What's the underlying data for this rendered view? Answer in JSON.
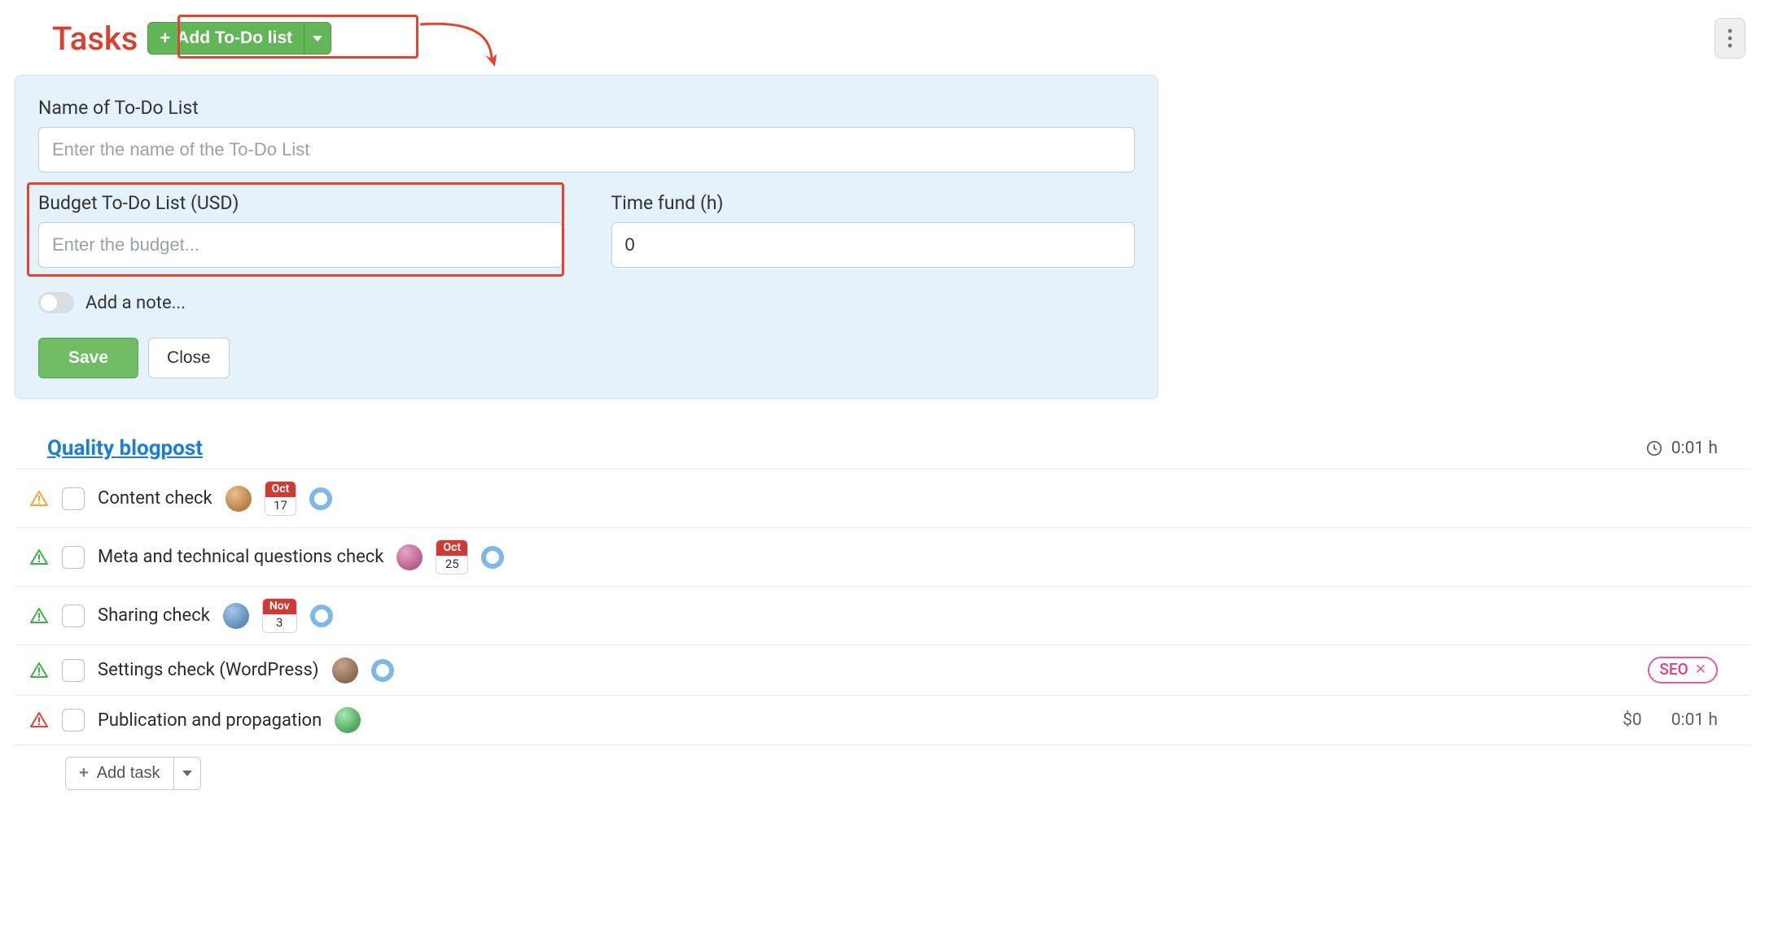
{
  "header": {
    "title": "Tasks",
    "add_button": "Add To-Do list"
  },
  "form": {
    "name_label": "Name of To-Do List",
    "name_placeholder": "Enter the name of the To-Do List",
    "budget_label": "Budget To-Do List (USD)",
    "budget_placeholder": "Enter the budget...",
    "timefund_label": "Time fund (h)",
    "timefund_value": "0",
    "note_label": "Add a note...",
    "save": "Save",
    "close": "Close"
  },
  "list": {
    "title": "Quality blogpost",
    "header_time": "0:01 h"
  },
  "tasks": [
    {
      "name": "Content check",
      "warn": "orange",
      "month": "Oct",
      "day": "17",
      "avatar": "av1",
      "status_ring": true
    },
    {
      "name": "Meta and technical questions check",
      "warn": "green",
      "month": "Oct",
      "day": "25",
      "avatar": "av2",
      "status_ring": true
    },
    {
      "name": "Sharing check",
      "warn": "green",
      "month": "Nov",
      "day": "3",
      "avatar": "av3",
      "status_ring": true
    },
    {
      "name": "Settings check (WordPress)",
      "warn": "green",
      "avatar": "av4",
      "status_ring": true,
      "tag": "SEO"
    },
    {
      "name": "Publication and propagation",
      "warn": "red",
      "avatar": "av5",
      "cost": "$0",
      "time": "0:01 h"
    }
  ],
  "add_task_label": "Add task"
}
